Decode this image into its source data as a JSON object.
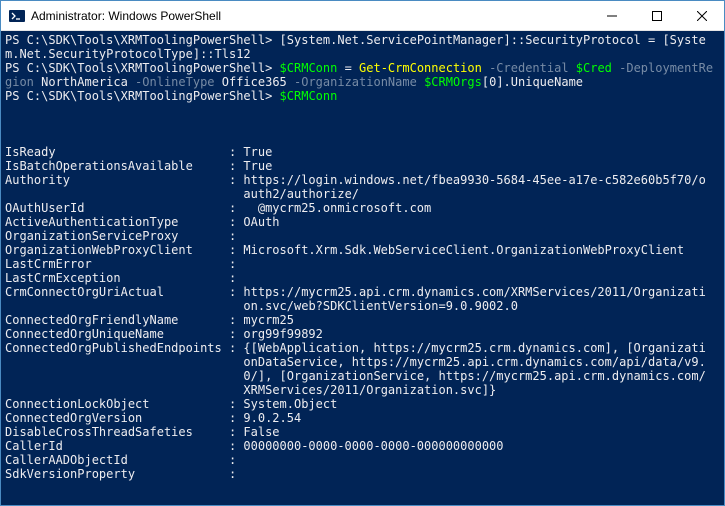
{
  "titlebar": {
    "title": "Administrator: Windows PowerShell",
    "min_tip": "Minimize",
    "max_tip": "Maximize",
    "close_tip": "Close"
  },
  "console": {
    "prompt": "PS C:\\SDK\\Tools\\XRMToolingPowerShell>",
    "cmd1_a": "[System.Net.ServicePointManager]::",
    "cmd1_b": "SecurityProtocol",
    "cmd1_c": " = [System.Net.SecurityProtocolType]::Tls12",
    "cmd2_var": "$CRMConn",
    "cmd2_eq": " = ",
    "cmd2_cmd": "Get-CrmConnection",
    "cmd2_p1": " -Credential ",
    "cmd2_v1": "$Cred",
    "cmd2_p2": " -DeploymentRegion ",
    "cmd2_v2": "NorthAmerica",
    "cmd2_p3": " -OnlineType ",
    "cmd2_v3": "Office365",
    "cmd2_p4": " -OrganizationName ",
    "cmd2_v4a": "$CRMOrgs",
    "cmd2_v4b": "[",
    "cmd2_v4c": "0",
    "cmd2_v4d": "].UniqueName",
    "cmd3_var": "$CRMConn",
    "out": {
      "IsReady": "True",
      "IsBatchOperationsAvailable": "True",
      "Authority": "https://login.windows.net/fbea9930-5684-45ee-a17e-c582e60b5f70/oauth2/authorize/",
      "OAuthUserId": "  @mycrm25.onmicrosoft.com",
      "ActiveAuthenticationType": "OAuth",
      "OrganizationServiceProxy": "",
      "OrganizationWebProxyClient": "Microsoft.Xrm.Sdk.WebServiceClient.OrganizationWebProxyClient",
      "LastCrmError": "",
      "LastCrmException": "",
      "CrmConnectOrgUriActual": "https://mycrm25.api.crm.dynamics.com/XRMServices/2011/Organization.svc/web?SDKClientVersion=9.0.9002.0",
      "ConnectedOrgFriendlyName": "mycrm25",
      "ConnectedOrgUniqueName": "org99f99892",
      "ConnectedOrgPublishedEndpoints": "{[WebApplication, https://mycrm25.crm.dynamics.com], [OrganizationDataService, https://mycrm25.api.crm.dynamics.com/api/data/v9.0/], [OrganizationService, https://mycrm25.api.crm.dynamics.com/XRMServices/2011/Organization.svc]}",
      "ConnectionLockObject": "System.Object",
      "ConnectedOrgVersion": "9.0.2.54",
      "DisableCrossThreadSafeties": "False",
      "CallerId": "00000000-0000-0000-0000-000000000000",
      "CallerAADObjectId": "",
      "SdkVersionProperty": ""
    }
  }
}
